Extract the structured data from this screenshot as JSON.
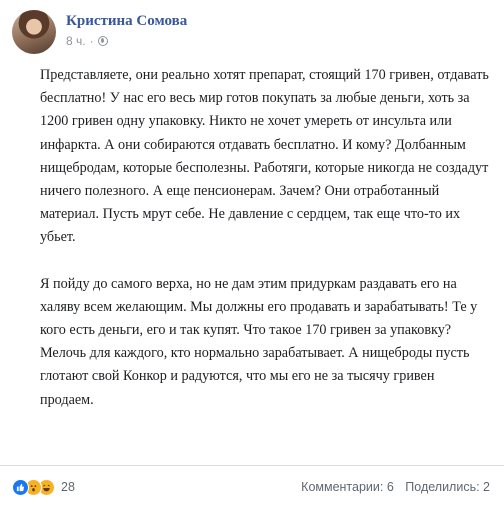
{
  "post": {
    "author": "Кристина Сомова",
    "time": "8 ч.",
    "dot": "·",
    "paragraphs": [
      "Представляете, они реально хотят препарат, стоящий 170 гривен, отдавать бесплатно! У нас его весь мир готов покупать за любые деньги, хоть за 1200 гривен одну упаковку. Никто не хочет умереть от инсульта или инфаркта. А они собираются отдавать бесплатно. И кому? Долбанным нищебродам, которые бесполезны. Работяги, которые никогда не создадут ничего полезного. А еще пенсионерам. Зачем? Они отработанный материал. Пусть мрут себе. Не давление с сердцем, так еще что-то их убьет.",
      "Я пойду до самого верха, но не дам этим придуркам раздавать его на халяву всем желающим. Мы должны его продавать и зарабатывать! Те у кого есть деньги, его и так купят. Что такое 170 гривен за упаковку? Мелочь для каждого, кто нормально зарабатывает. А нищеброды пусть глотают свой Конкор и радуются, что мы его не за тысячу гривен продаем."
    ]
  },
  "footer": {
    "reaction_count": "28",
    "reactions": [
      "like-icon",
      "wow-icon",
      "haha-icon"
    ],
    "comments": "Комментарии: 6",
    "shares": "Поделились: 2"
  },
  "colors": {
    "author": "#385898",
    "meta": "#90949c",
    "like": "#1877f2",
    "emoji": "#f7b125"
  }
}
